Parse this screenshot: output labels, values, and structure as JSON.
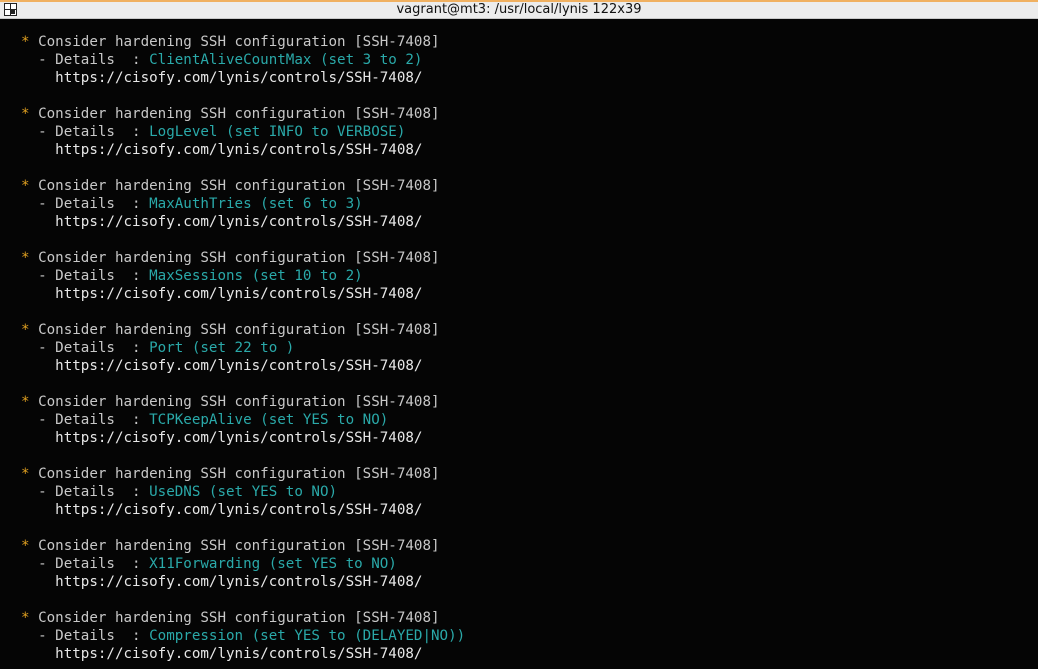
{
  "window": {
    "title": "vagrant@mt3: /usr/local/lynis 122x39"
  },
  "terminal": {
    "entries": [
      {
        "star": "*",
        "heading": " Consider hardening SSH configuration [SSH-7408]",
        "detail_prefix": "  - Details  : ",
        "detail_value": "ClientAliveCountMax (set 3 to 2)",
        "url": "    https://cisofy.com/lynis/controls/SSH-7408/"
      },
      {
        "star": "*",
        "heading": " Consider hardening SSH configuration [SSH-7408]",
        "detail_prefix": "  - Details  : ",
        "detail_value": "LogLevel (set INFO to VERBOSE)",
        "url": "    https://cisofy.com/lynis/controls/SSH-7408/"
      },
      {
        "star": "*",
        "heading": " Consider hardening SSH configuration [SSH-7408]",
        "detail_prefix": "  - Details  : ",
        "detail_value": "MaxAuthTries (set 6 to 3)",
        "url": "    https://cisofy.com/lynis/controls/SSH-7408/"
      },
      {
        "star": "*",
        "heading": " Consider hardening SSH configuration [SSH-7408]",
        "detail_prefix": "  - Details  : ",
        "detail_value": "MaxSessions (set 10 to 2)",
        "url": "    https://cisofy.com/lynis/controls/SSH-7408/"
      },
      {
        "star": "*",
        "heading": " Consider hardening SSH configuration [SSH-7408]",
        "detail_prefix": "  - Details  : ",
        "detail_value": "Port (set 22 to )",
        "url": "    https://cisofy.com/lynis/controls/SSH-7408/"
      },
      {
        "star": "*",
        "heading": " Consider hardening SSH configuration [SSH-7408]",
        "detail_prefix": "  - Details  : ",
        "detail_value": "TCPKeepAlive (set YES to NO)",
        "url": "    https://cisofy.com/lynis/controls/SSH-7408/"
      },
      {
        "star": "*",
        "heading": " Consider hardening SSH configuration [SSH-7408]",
        "detail_prefix": "  - Details  : ",
        "detail_value": "UseDNS (set YES to NO)",
        "url": "    https://cisofy.com/lynis/controls/SSH-7408/"
      },
      {
        "star": "*",
        "heading": " Consider hardening SSH configuration [SSH-7408]",
        "detail_prefix": "  - Details  : ",
        "detail_value": "X11Forwarding (set YES to NO)",
        "url": "    https://cisofy.com/lynis/controls/SSH-7408/"
      },
      {
        "star": "*",
        "heading": " Consider hardening SSH configuration [SSH-7408]",
        "detail_prefix": "  - Details  : ",
        "detail_value": "Compression (set YES to (DELAYED|NO))",
        "url": "    https://cisofy.com/lynis/controls/SSH-7408/"
      }
    ],
    "colors": {
      "background": "#050505",
      "text": "#c8c8c8",
      "star": "#e0a020",
      "value": "#2aa9a9"
    }
  }
}
